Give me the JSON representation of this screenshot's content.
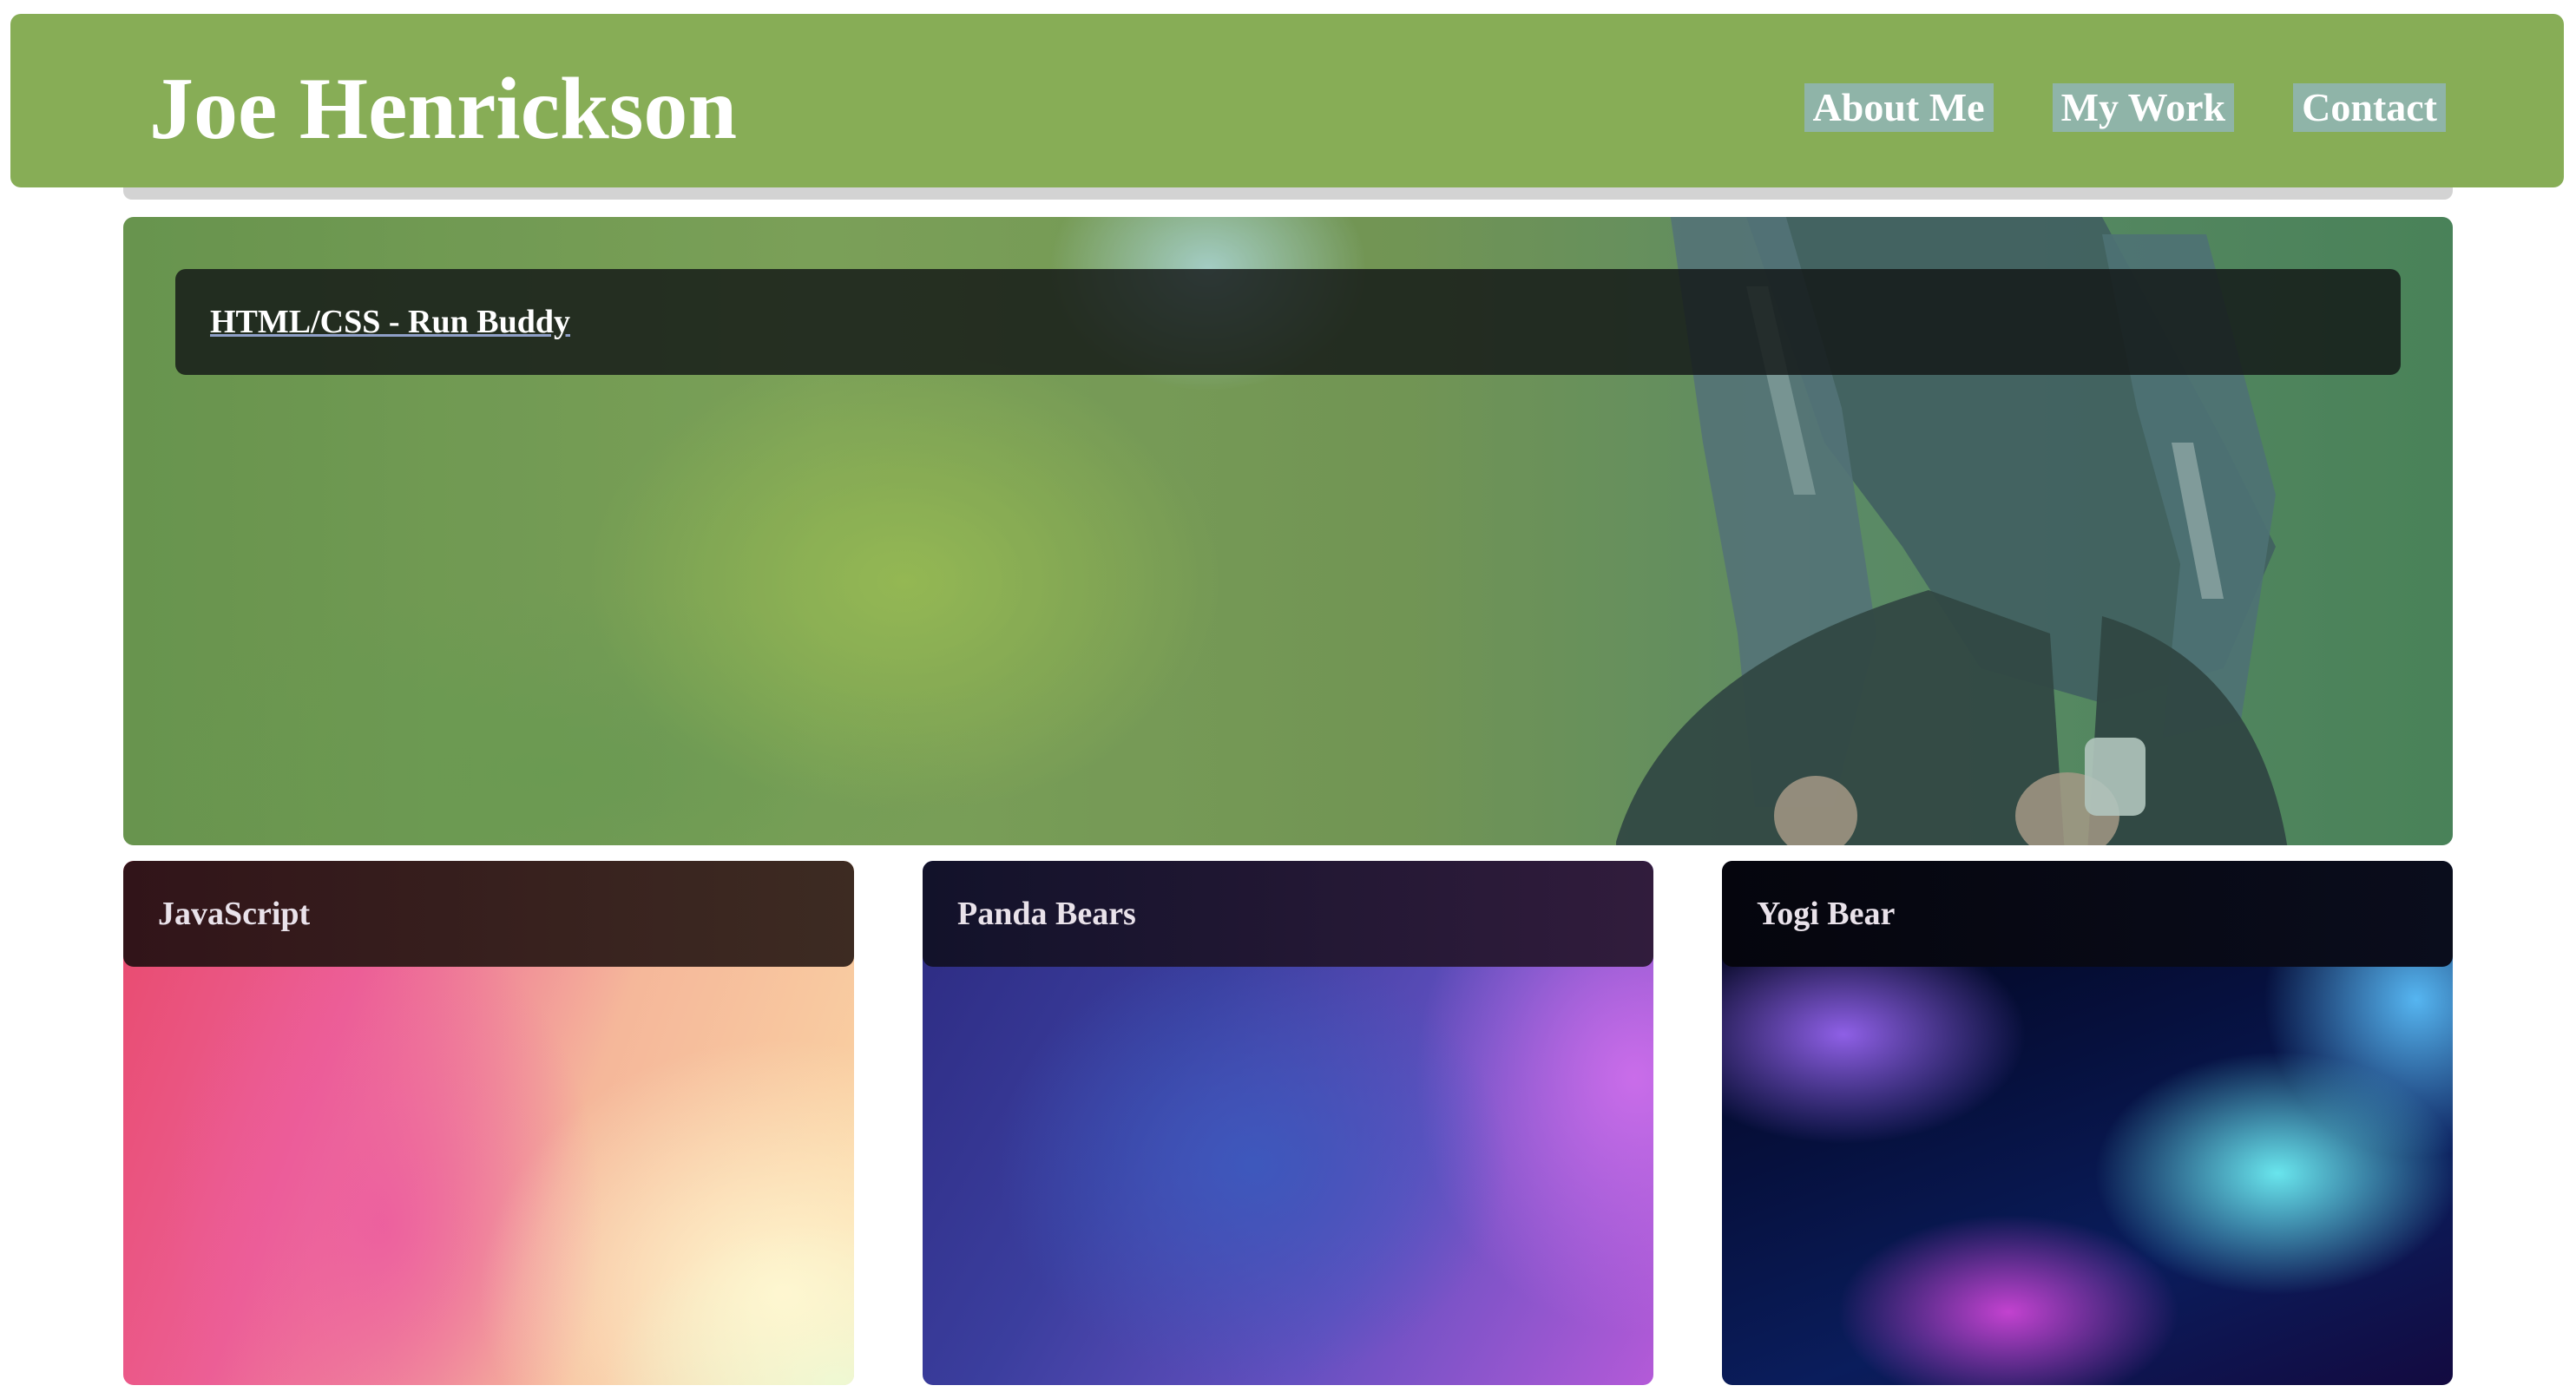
{
  "header": {
    "title": "Joe Henrickson",
    "nav": [
      {
        "label": "About Me"
      },
      {
        "label": "My Work"
      },
      {
        "label": "Contact"
      }
    ]
  },
  "hero": {
    "title": "HTML/CSS - Run Buddy"
  },
  "cards": [
    {
      "title": "JavaScript"
    },
    {
      "title": "Panda Bears"
    },
    {
      "title": "Yogi Bear"
    }
  ],
  "colors": {
    "header_bg": "#87ad56",
    "nav_highlight": "#8fb4a8",
    "title_text": "#ffffff"
  }
}
